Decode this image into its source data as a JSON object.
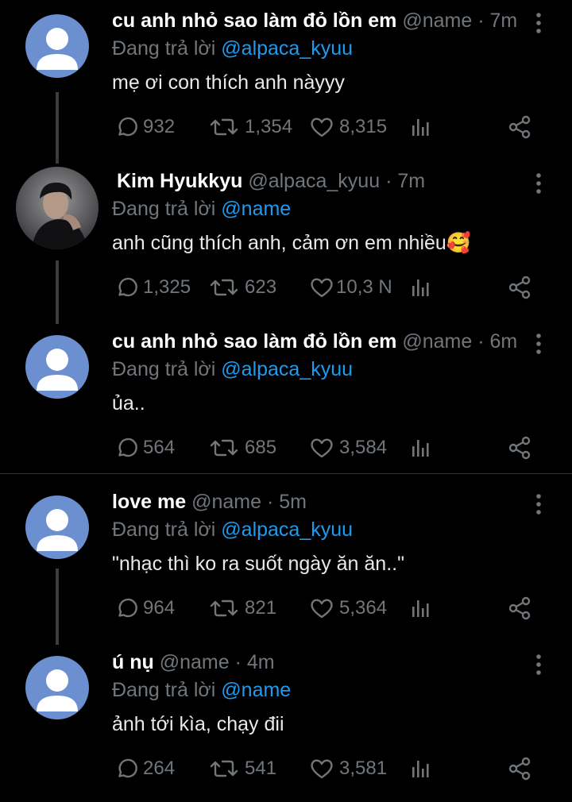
{
  "colors": {
    "background": "#000000",
    "muted": "#71767b",
    "link": "#1d9bf0",
    "text": "#e7e9ea"
  },
  "tweets": [
    {
      "name": "cu anh nhỏ sao làm đỏ lồn em",
      "handle": "@name",
      "time": "· 7m",
      "reply_prefix": "Đang trả lời ",
      "reply_to": "@alpaca_kyuu",
      "text": "mẹ ơi con thích anh nàyyy",
      "replies": "932",
      "retweets": "1,354",
      "likes": "8,315",
      "avatar": "default-avatar"
    },
    {
      "name": "Kim Hyukkyu",
      "handle": "@alpaca_kyuu",
      "time": "· 7m",
      "reply_prefix": "Đang trả lời ",
      "reply_to": "@name",
      "text": "anh cũng thích anh, cảm ơn em nhiều",
      "emoji": "🥰",
      "replies": "1,325",
      "retweets": "623",
      "likes": "10,3 N",
      "avatar": "photo-avatar"
    },
    {
      "name": "cu anh nhỏ sao làm đỏ lồn em",
      "handle": "@name",
      "time": "· 6m",
      "reply_prefix": "Đang trả lời ",
      "reply_to": "@alpaca_kyuu",
      "text": "ủa..",
      "replies": "564",
      "retweets": "685",
      "likes": "3,584",
      "avatar": "default-avatar"
    },
    {
      "name": "love me",
      "handle": "@name",
      "time": "· 5m",
      "reply_prefix": "Đang trả lời ",
      "reply_to": "@alpaca_kyuu",
      "text": "\"nhạc thì ko ra suốt ngày ăn ăn..\"",
      "replies": "964",
      "retweets": "821",
      "likes": "5,364",
      "avatar": "default-avatar"
    },
    {
      "name": "ú nụ",
      "handle": "@name",
      "time": "· 4m",
      "reply_prefix": "Đang trả lời ",
      "reply_to": "@name",
      "text": "ảnh tới kìa, chạy đii",
      "replies": "264",
      "retweets": "541",
      "likes": "3,581",
      "avatar": "default-avatar"
    }
  ]
}
